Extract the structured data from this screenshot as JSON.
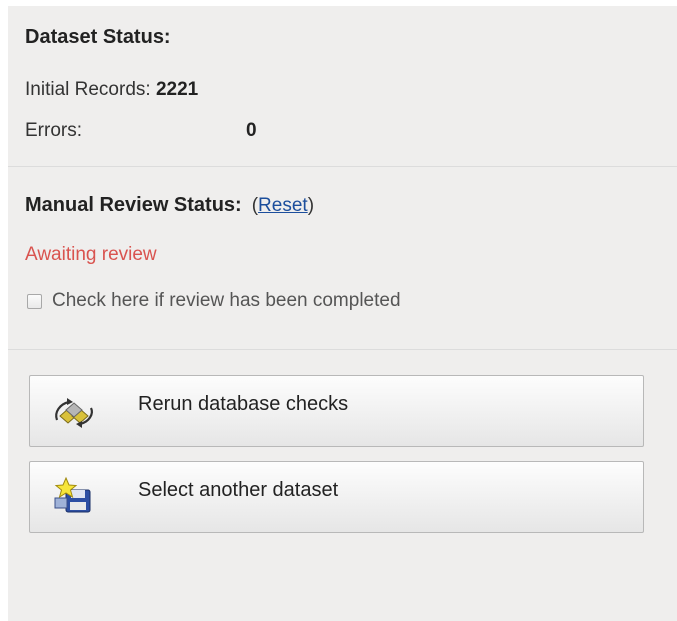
{
  "dataset_status": {
    "title": "Dataset Status:",
    "initial_records_label": "Initial Records:",
    "initial_records_value": "2221",
    "errors_label": "Errors:",
    "errors_value": "0"
  },
  "manual_review": {
    "title": "Manual Review Status:",
    "reset_open": "(",
    "reset_label": "Reset",
    "reset_close": ")",
    "status": "Awaiting review",
    "status_color": "#d9534f",
    "checkbox_label": "Check here if review has been completed",
    "checkbox_checked": false
  },
  "actions": {
    "rerun": {
      "label": "Rerun database checks",
      "icon": "database-check-icon"
    },
    "select": {
      "label": "Select another dataset",
      "icon": "select-dataset-icon"
    }
  }
}
